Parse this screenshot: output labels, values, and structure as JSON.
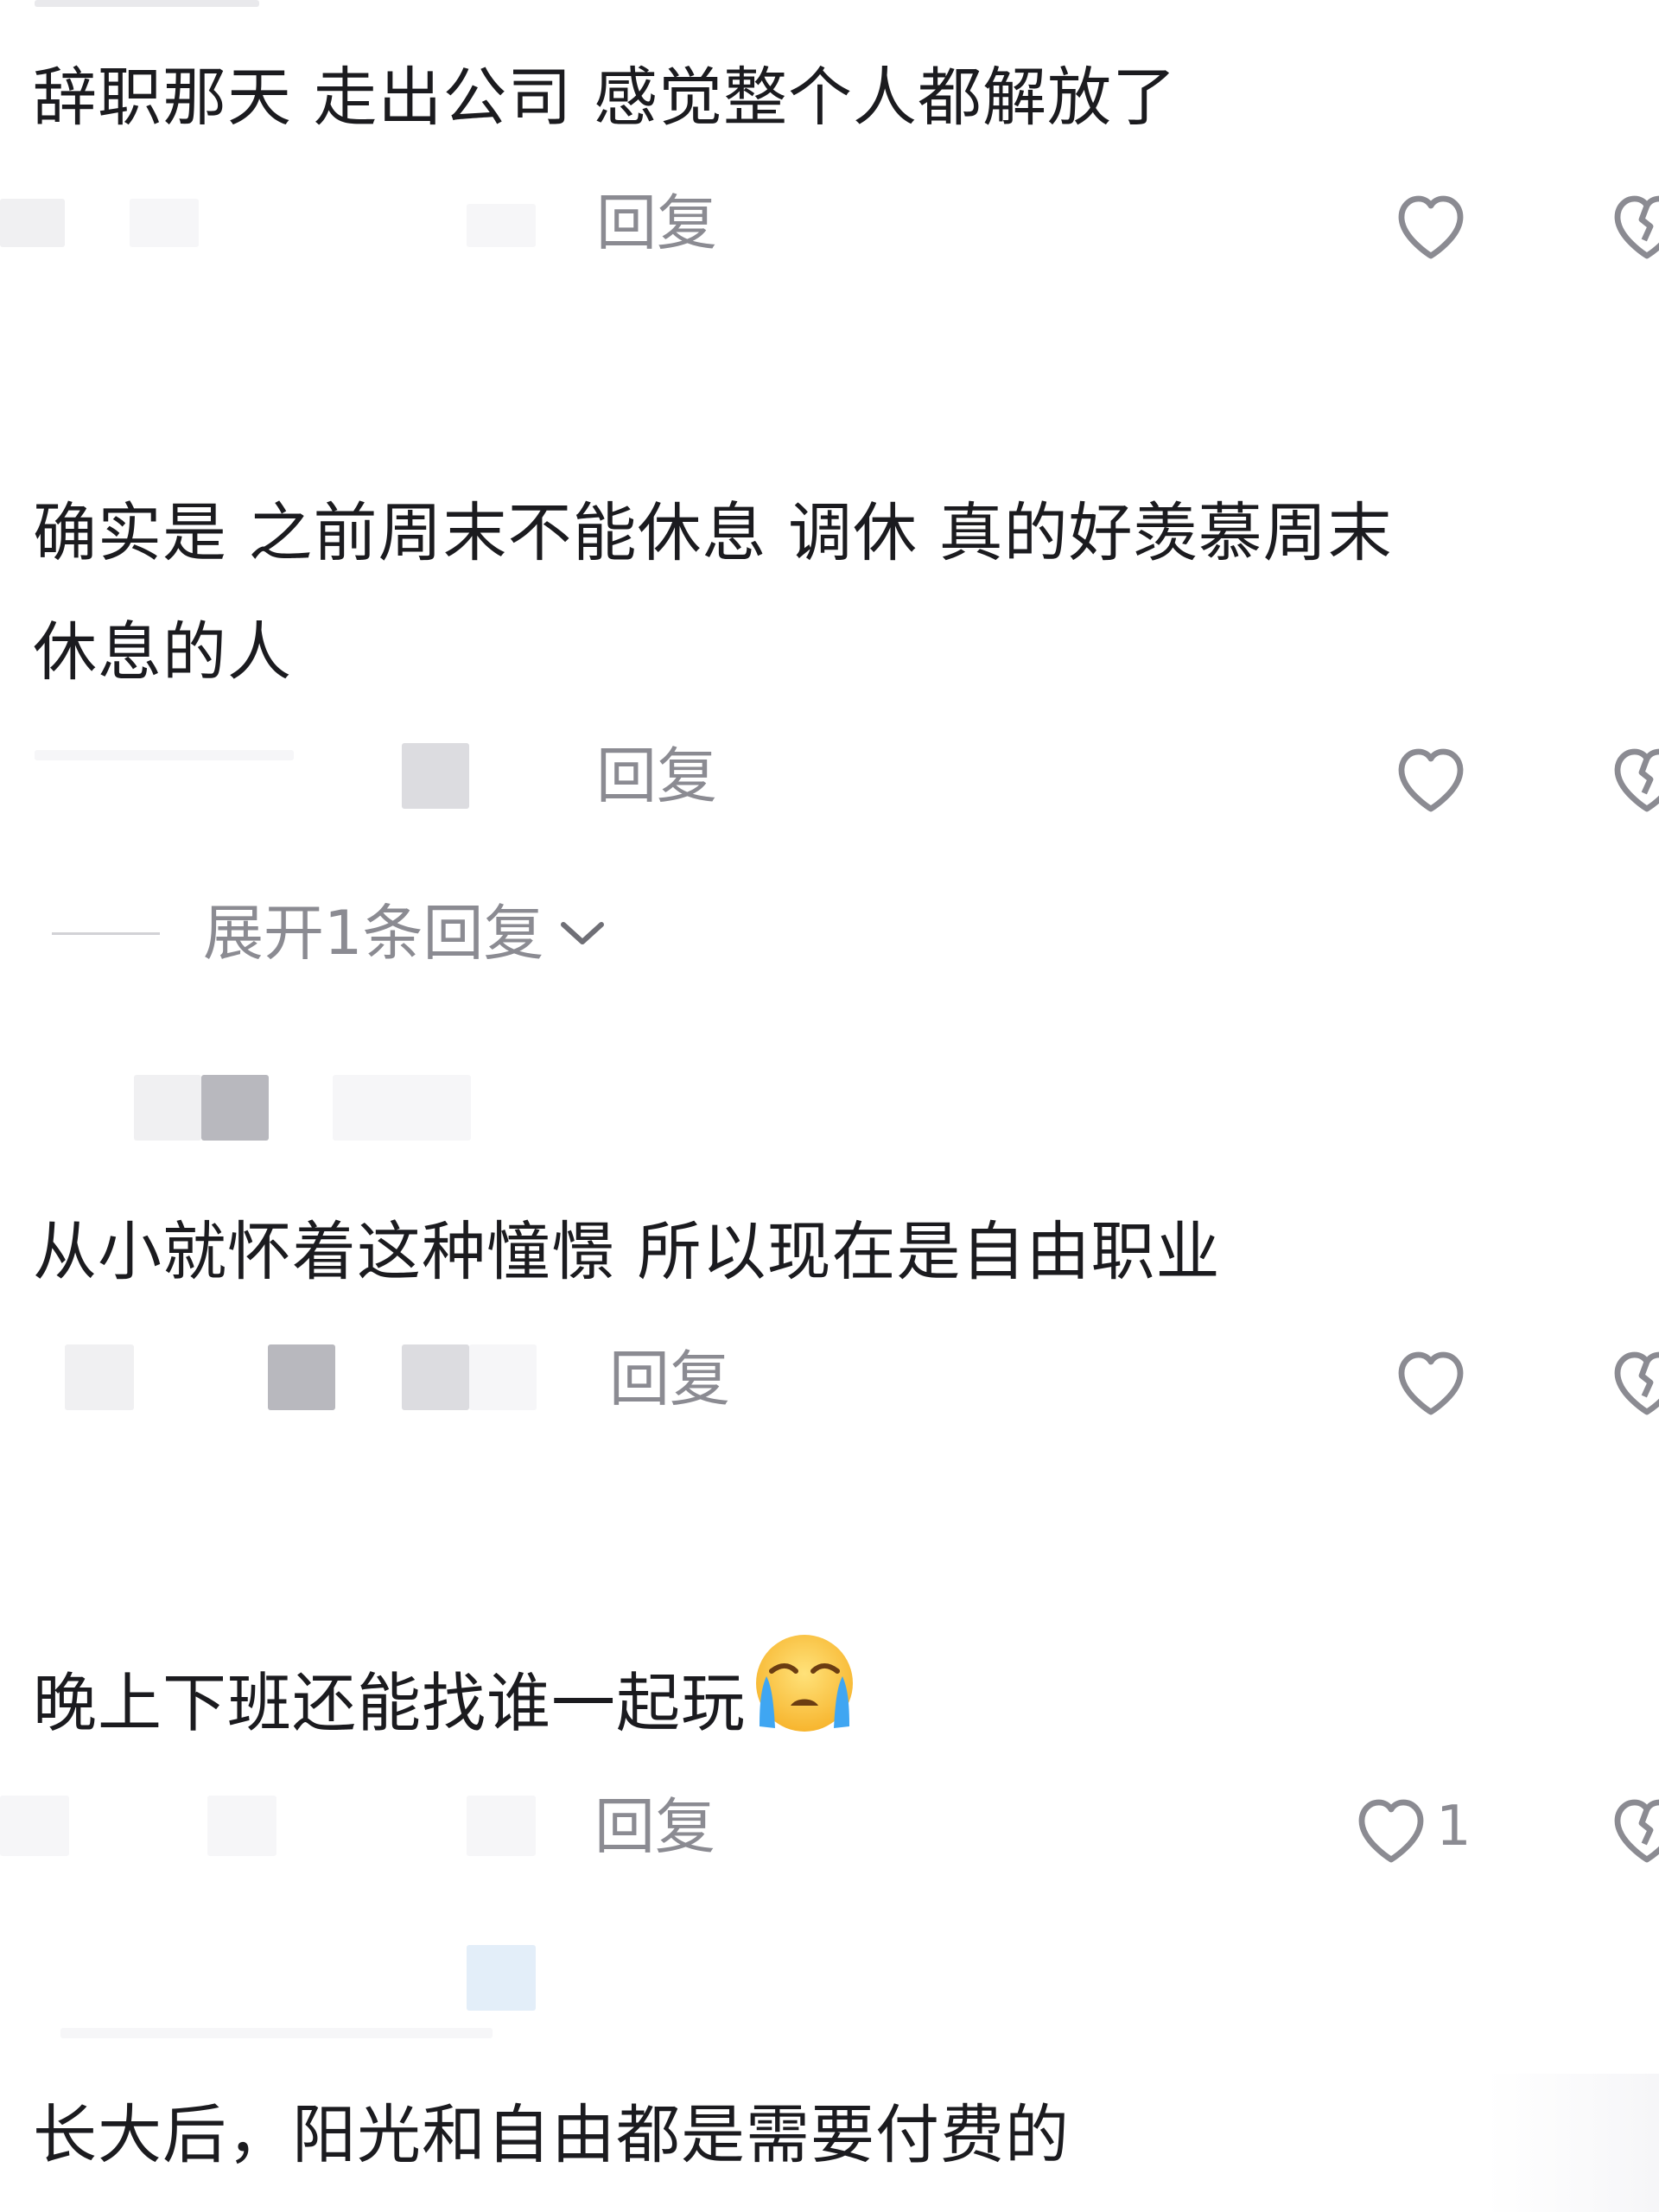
{
  "comments": [
    {
      "text_lines": [
        "辞职那天 走出公司 感觉整个人都解放了"
      ],
      "reply_label": "回复",
      "like_count": ""
    },
    {
      "text_lines": [
        "确实是 之前周末不能休息 调休 真的好羡慕周末",
        "休息的人"
      ],
      "reply_label": "回复",
      "like_count": ""
    },
    {
      "text_lines": [
        "从小就怀着这种憧憬 所以现在是自由职业"
      ],
      "reply_label": "回复",
      "like_count": ""
    },
    {
      "text_lines": [
        "晚上下班还能找谁一起玩"
      ],
      "emoji": "loudly-crying-face",
      "reply_label": "回复",
      "like_count": "1"
    },
    {
      "text_lines": [
        "长大后，阳光和自由都是需要付费的"
      ]
    }
  ],
  "expand_replies": {
    "label": "展开1条回复"
  },
  "icons": {
    "like": "heart-outline-icon",
    "dislike": "broken-heart-icon",
    "expand": "chevron-down-icon"
  },
  "colors": {
    "text": "#1b1b1f",
    "secondary": "#8b8b92",
    "icon": "#8b8b92"
  }
}
